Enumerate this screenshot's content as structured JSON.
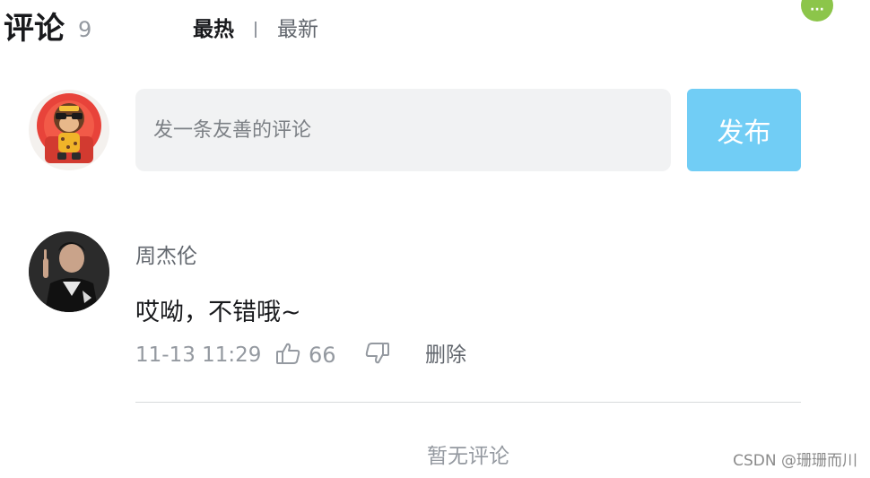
{
  "header": {
    "title": "评论",
    "count": "9",
    "sort_hot": "最热",
    "sort_new": "最新",
    "corner_badge": "···"
  },
  "composer": {
    "placeholder": "发一条友善的评论",
    "publish_label": "发布"
  },
  "comments": [
    {
      "user": "周杰伦",
      "content": "哎呦，不错哦~",
      "time": "11-13 11:29",
      "likes": "66",
      "delete_label": "删除"
    }
  ],
  "footer": {
    "no_more": "暂无评论"
  },
  "watermark": "CSDN @珊珊而川",
  "colors": {
    "accent": "#71cdf5",
    "input_bg": "#f1f2f3",
    "muted_text": "#9499a0",
    "badge": "#8cc54a"
  },
  "icons": {
    "like": "thumbs-up-icon",
    "dislike": "thumbs-down-icon",
    "more": "more-dots-icon"
  }
}
